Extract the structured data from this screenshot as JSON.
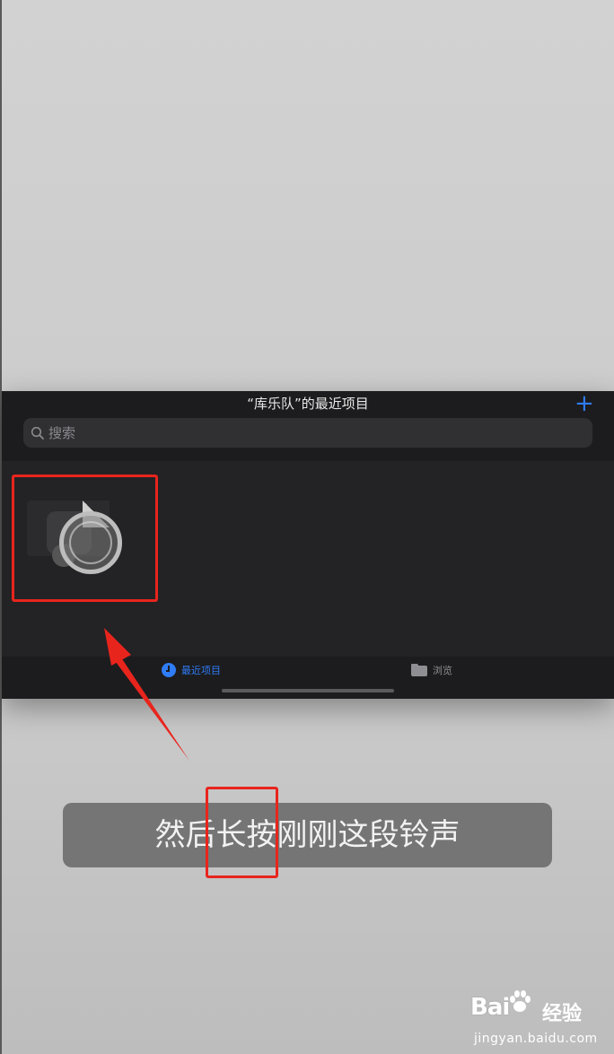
{
  "sheet": {
    "title": "“库乐队”的最近项目",
    "add_label": "+",
    "search": {
      "placeholder": "搜索",
      "value": ""
    }
  },
  "file_item": {
    "icon": "garageband-project-icon"
  },
  "tab_bar": {
    "recent_label": "最近项目",
    "browse_label": "浏览"
  },
  "caption": {
    "text": "然后长按刚刚这段铃声"
  },
  "watermark": {
    "brand_prefix": "Bai",
    "brand_suffix": "经验",
    "url": "jingyan.baidu.com"
  },
  "colors": {
    "accent": "#2f7cf6",
    "highlight": "#e8251d",
    "sheet_bg": "#232225"
  }
}
